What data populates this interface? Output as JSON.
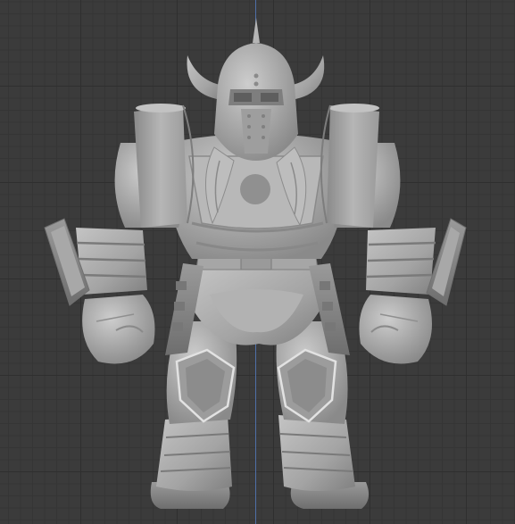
{
  "viewport": {
    "background_color": "#3b3b3b",
    "grid_major_color": "#2f2f2f",
    "grid_minor_color": "#353535",
    "z_axis_color": "#4f6fa8",
    "model_color": "#a9a9a9"
  },
  "model": {
    "icon": "armored-warrior-figure"
  }
}
